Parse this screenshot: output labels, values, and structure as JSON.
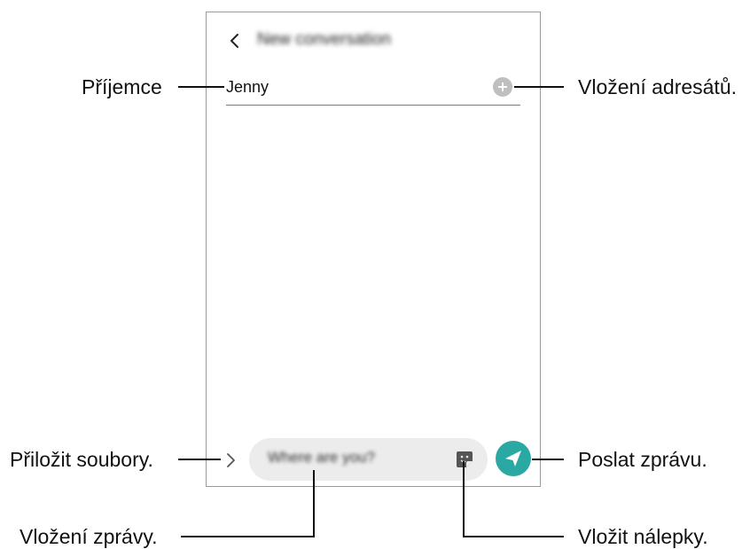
{
  "screen": {
    "header": {
      "title": "New conversation"
    },
    "recipient": {
      "value": "Jenny"
    },
    "composer": {
      "placeholder": "Where are you?"
    }
  },
  "callouts": {
    "recipient": "Příjemce",
    "add_recipients": "Vložení adresátů.",
    "attach_files": "Přiložit soubory.",
    "send_message": "Poslat zprávu.",
    "enter_message": "Vložení zprávy.",
    "insert_stickers": "Vložit nálepky."
  },
  "colors": {
    "send_button": "#2aa8a3",
    "add_button": "#bfbfbf",
    "sticker_icon": "#555555"
  },
  "icons": [
    "chevron-left-icon",
    "plus-icon",
    "chevron-right-icon",
    "sticker-icon",
    "send-icon"
  ]
}
